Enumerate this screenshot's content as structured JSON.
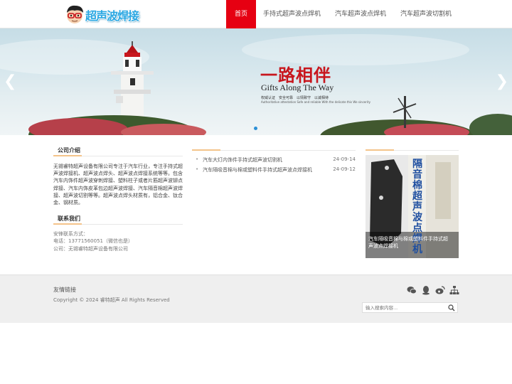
{
  "header": {
    "logo_text": "超声波焊接",
    "nav": [
      {
        "label": "首页",
        "active": true
      },
      {
        "label": "手持式超声波点焊机",
        "active": false
      },
      {
        "label": "汽车超声波点焊机",
        "active": false
      },
      {
        "label": "汽车超声波切割机",
        "active": false
      }
    ]
  },
  "banner": {
    "slogan_cn": "一路相伴",
    "slogan_en": "Gifts Along The Way",
    "tags_cn": "权威认证　安全可靠　以情致守　以诚相待",
    "tags_en": "Authoritative attestation   Safe and reliable   With the delicate this   We sincerity",
    "prev_icon": "chevron-left-icon",
    "next_icon": "chevron-right-icon",
    "active_slide": 1
  },
  "about": {
    "title": "公司介绍",
    "text": "无锡睿特超声设备有限公司专注于汽车行业，专注手持式超声波焊接机、超声波点焊头、超声波点焊接系统等等。包含汽车内饰件超声波穿刺焊接、塑料柱子或者片筋超声波铆点焊接、汽车内饰皮革包边超声波焊接、汽车隔音棉超声波焊接、超声波切割等等。超声波点焊头材质有，铝合金、钛合金、钢材质。"
  },
  "contact": {
    "title": "联系我们",
    "lines": [
      "安锋联系方式：",
      "电话：13771560051（微信也是）",
      "公司：无锡睿特超声设备有限公司"
    ]
  },
  "news": [
    {
      "title": "汽车大灯内饰件手持式超声波切割机",
      "date": "24-09-14"
    },
    {
      "title": "汽车隔吸音棉与棉或塑料件手持式超声波点焊接机",
      "date": "24-09-12"
    }
  ],
  "product": {
    "image_text": "隔音棉超声波点焊机",
    "caption": "汽车隔吸音棉与棉或塑料件手持式超声波点焊接机"
  },
  "footer": {
    "links_title": "友情链接",
    "copyright": "Copyright © 2024 睿特超声 All Rights Reserved",
    "social_icons": [
      "wechat-icon",
      "qq-icon",
      "weibo-icon",
      "sitemap-icon"
    ],
    "search_placeholder": "输入搜索内容..."
  },
  "colors": {
    "accent": "#e60012",
    "brand_blue": "#2aa7e2",
    "divider_accent": "#f4c48a"
  }
}
